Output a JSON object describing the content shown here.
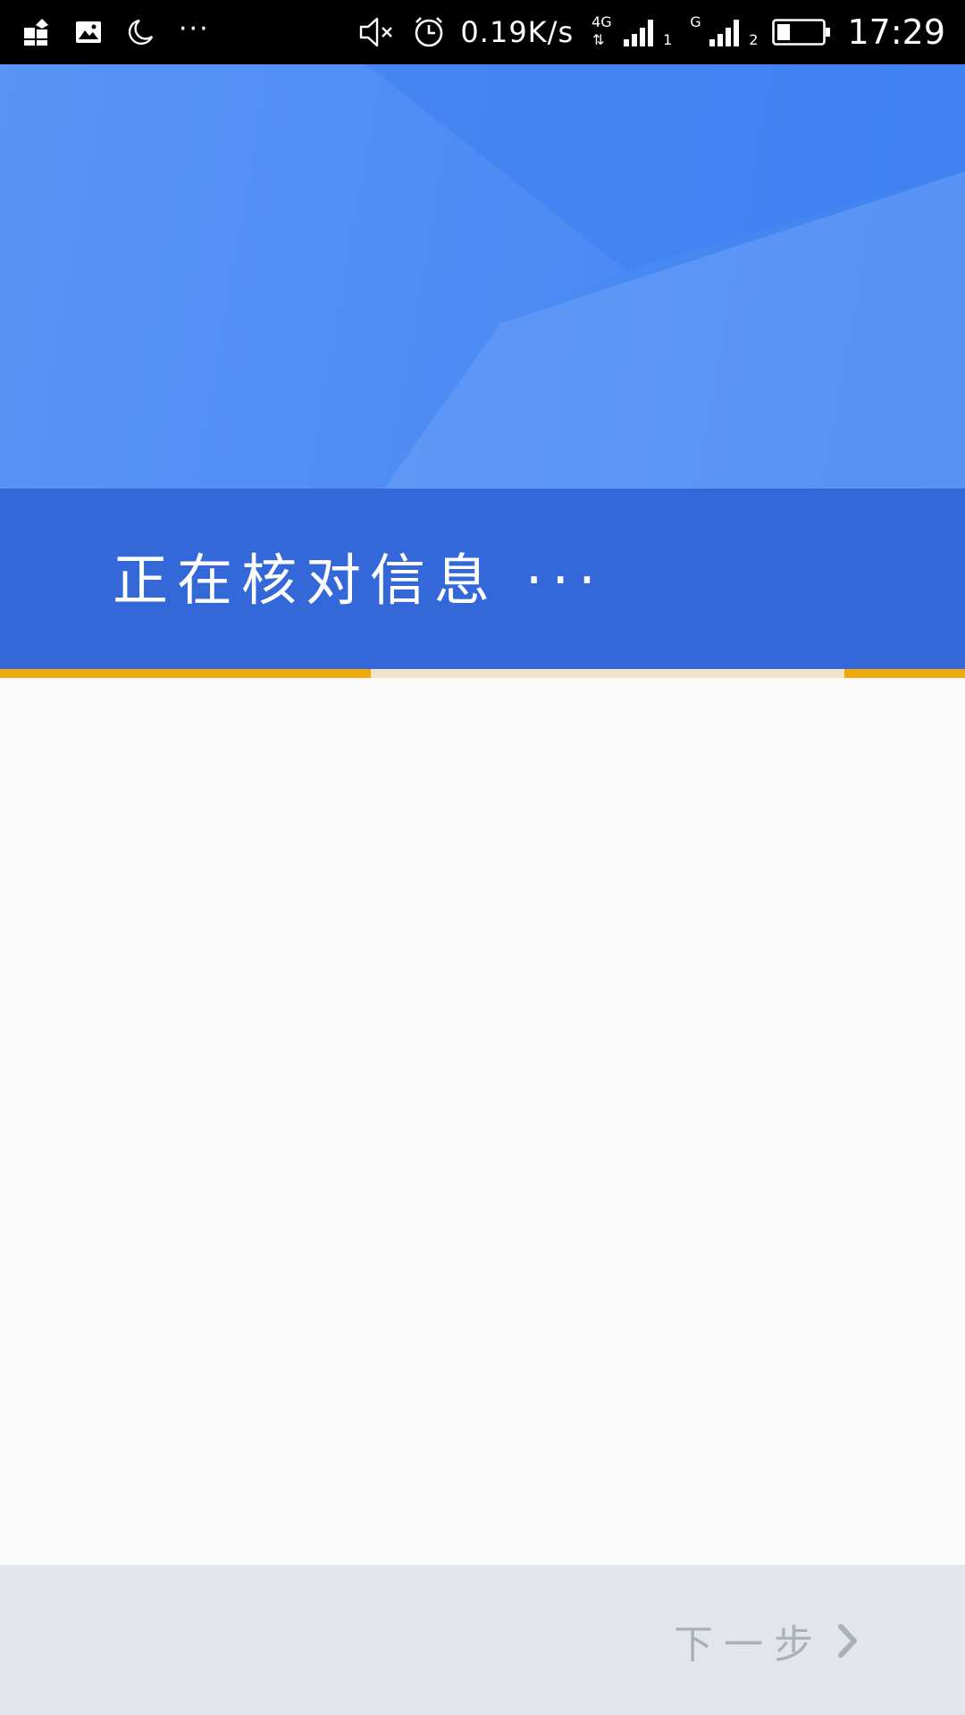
{
  "status_bar": {
    "left_icons": [
      "app-grid-icon",
      "gallery-icon",
      "moon-icon",
      "more-dots-icon"
    ],
    "more_dots": "···",
    "net_speed": "0.19K/s",
    "sim1_network": "4G",
    "sim1_label": "1",
    "sim2_network": "G",
    "sim2_label": "2",
    "time": "17:29"
  },
  "header": {
    "title": "正在核对信息 ···"
  },
  "progress": {
    "color": "#f0a90c",
    "track_color": "#efe3c8"
  },
  "footer": {
    "next_label": "下一步"
  },
  "colors": {
    "primary_blue": "#4c8cf4",
    "title_band": "#3468d8",
    "footer_bg": "#e2e6ea",
    "next_text": "#a9b0b7"
  }
}
